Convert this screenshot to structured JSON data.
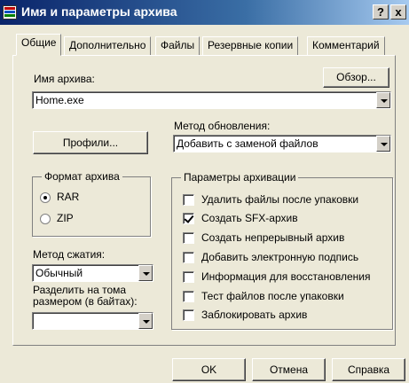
{
  "window": {
    "title": "Имя и параметры архива",
    "help_button": "?",
    "close_button": "x"
  },
  "tabs": [
    {
      "label": "Общие",
      "active": true
    },
    {
      "label": "Дополнительно",
      "active": false
    },
    {
      "label": "Файлы",
      "active": false
    },
    {
      "label": "Резервные копии",
      "active": false
    },
    {
      "label": "Комментарий",
      "active": false
    }
  ],
  "general": {
    "archive_name_label": "Имя архива:",
    "archive_name_value": "Home.exe",
    "browse_button": "Обзор...",
    "update_method_label": "Метод обновления:",
    "update_method_value": "Добавить с заменой файлов",
    "profiles_button": "Профили...",
    "format_group_title": "Формат архива",
    "format_options": [
      {
        "label": "RAR",
        "checked": true
      },
      {
        "label": "ZIP",
        "checked": false
      }
    ],
    "compression_label": "Метод сжатия:",
    "compression_value": "Обычный",
    "split_label_line1": "Разделить на тома",
    "split_label_line2": "размером (в байтах):",
    "split_value": "",
    "options_group_title": "Параметры архивации",
    "options": [
      {
        "label": "Удалить файлы после упаковки",
        "checked": false
      },
      {
        "label": "Создать SFX-архив",
        "checked": true
      },
      {
        "label": "Создать непрерывный архив",
        "checked": false
      },
      {
        "label": "Добавить электронную подпись",
        "checked": false
      },
      {
        "label": "Информация для восстановления",
        "checked": false
      },
      {
        "label": "Тест файлов после упаковки",
        "checked": false
      },
      {
        "label": "Заблокировать архив",
        "checked": false
      }
    ]
  },
  "footer": {
    "ok_button": "OK",
    "cancel_button": "Отмена",
    "help_button": "Справка"
  },
  "colors": {
    "titlebar_start": "#0a246a",
    "titlebar_end": "#a6caf0",
    "face": "#ece9d8"
  }
}
